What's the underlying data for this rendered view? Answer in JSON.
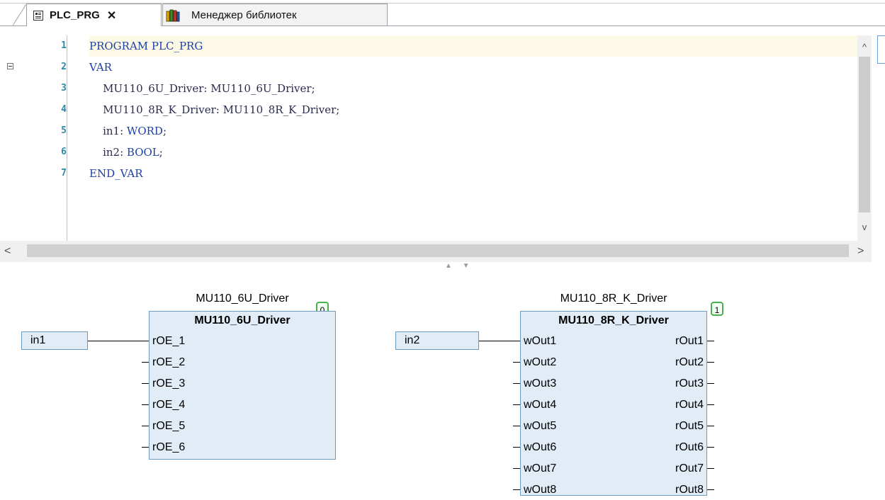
{
  "tabs": [
    {
      "label": "PLC_PRG",
      "active": true,
      "icon": "program-icon",
      "close": "✕"
    },
    {
      "label": "Менеджер библиотек",
      "active": false,
      "icon": "library-books-icon"
    }
  ],
  "editor": {
    "lines": [
      {
        "num": "1",
        "indent": "",
        "text": "PROGRAM PLC_PRG"
      },
      {
        "num": "2",
        "indent": "",
        "text": "VAR"
      },
      {
        "num": "3",
        "indent": "    ",
        "text": "MU110_6U_Driver: MU110_6U_Driver;"
      },
      {
        "num": "4",
        "indent": "    ",
        "text": "MU110_8R_K_Driver: MU110_8R_K_Driver;"
      },
      {
        "num": "5",
        "indent": "    ",
        "text_a": "in1: ",
        "kw": "WORD",
        "text_b": ";"
      },
      {
        "num": "6",
        "indent": "    ",
        "text_a": "in2: ",
        "kw": "BOOL",
        "text_b": ";"
      },
      {
        "num": "7",
        "indent": "",
        "text": "END_VAR"
      }
    ],
    "scroll_up": "^",
    "scroll_down": "v",
    "scroll_left": "<",
    "scroll_right": ">",
    "splitter": "▲ ▼"
  },
  "diagram": {
    "blocks": [
      {
        "instance": "MU110_6U_Driver",
        "type": "MU110_6U_Driver",
        "order": "0",
        "inputs": [
          "rOE_1",
          "rOE_2",
          "rOE_3",
          "rOE_4",
          "rOE_5",
          "rOE_6"
        ],
        "outputs": []
      },
      {
        "instance": "MU110_8R_K_Driver",
        "type": "MU110_8R_K_Driver",
        "order": "1",
        "inputs": [
          "wOut1",
          "wOut2",
          "wOut3",
          "wOut4",
          "wOut5",
          "wOut6",
          "wOut7",
          "wOut8"
        ],
        "outputs": [
          "rOut1",
          "rOut2",
          "rOut3",
          "rOut4",
          "rOut5",
          "rOut6",
          "rOut7",
          "rOut8"
        ]
      }
    ],
    "variables": [
      {
        "name": "in1"
      },
      {
        "name": "in2"
      }
    ]
  }
}
